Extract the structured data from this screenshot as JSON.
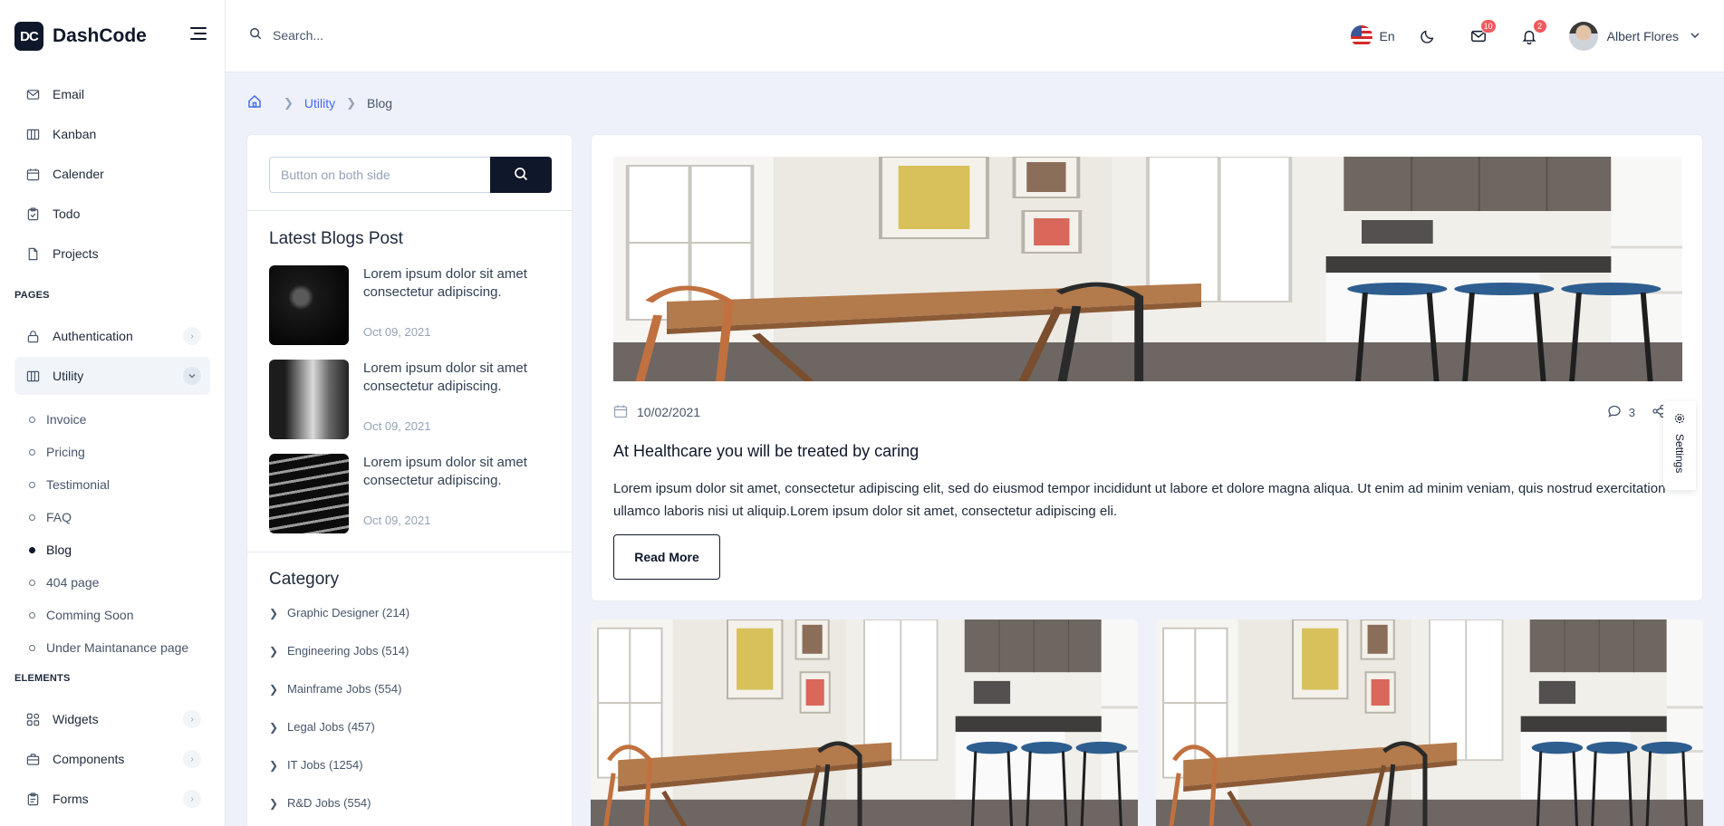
{
  "app": {
    "name": "DashCode",
    "logo_text": "DC"
  },
  "sidebar": {
    "top_items": [
      {
        "label": "Email",
        "icon": "mail-icon"
      },
      {
        "label": "Kanban",
        "icon": "columns-icon"
      },
      {
        "label": "Calender",
        "icon": "calendar-icon"
      },
      {
        "label": "Todo",
        "icon": "clipboard-icon"
      },
      {
        "label": "Projects",
        "icon": "document-icon"
      }
    ],
    "pages_label": "PAGES",
    "authentication": {
      "label": "Authentication",
      "icon": "lock-icon"
    },
    "utility": {
      "label": "Utility",
      "icon": "columns-icon",
      "expanded": true
    },
    "utility_sub": [
      {
        "label": "Invoice"
      },
      {
        "label": "Pricing"
      },
      {
        "label": "Testimonial"
      },
      {
        "label": "FAQ"
      },
      {
        "label": "Blog",
        "active": true
      },
      {
        "label": "404 page"
      },
      {
        "label": "Comming Soon"
      },
      {
        "label": "Under Maintanance page"
      }
    ],
    "elements_label": "ELEMENTS",
    "element_items": [
      {
        "label": "Widgets",
        "icon": "grid-icon"
      },
      {
        "label": "Components",
        "icon": "briefcase-icon"
      },
      {
        "label": "Forms",
        "icon": "clipboard-icon"
      }
    ]
  },
  "header": {
    "search_placeholder": "Search...",
    "language": "En",
    "mail_badge": "10",
    "notification_badge": "2",
    "user_name": "Albert Flores"
  },
  "breadcrumb": {
    "parent": "Utility",
    "current": "Blog"
  },
  "left_panel": {
    "search_placeholder": "Button on both side",
    "latest_heading": "Latest Blogs Post",
    "posts": [
      {
        "title": "Lorem ipsum dolor sit amet consectetur adipiscing.",
        "date": "Oct 09, 2021"
      },
      {
        "title": "Lorem ipsum dolor sit amet consectetur adipiscing.",
        "date": "Oct 09, 2021"
      },
      {
        "title": "Lorem ipsum dolor sit amet consectetur adipiscing.",
        "date": "Oct 09, 2021"
      }
    ],
    "category_heading": "Category",
    "categories": [
      {
        "label": "Graphic Designer (214)"
      },
      {
        "label": "Engineering Jobs (514)"
      },
      {
        "label": "Mainframe Jobs (554)"
      },
      {
        "label": "Legal Jobs (457)"
      },
      {
        "label": "IT Jobs (1254)"
      },
      {
        "label": "R&D Jobs (554)"
      }
    ]
  },
  "blog": {
    "date": "10/02/2021",
    "comments": "3",
    "title": "At Healthcare you will be treated by caring",
    "body": "Lorem ipsum dolor sit amet, consectetur adipiscing elit, sed do eiusmod tempor incididunt ut labore et dolore magna aliqua. Ut enim ad minim veniam, quis nostrud exercitation ullamco laboris nisi ut aliquip.Lorem ipsum dolor sit amet, consectetur adipiscing eli.",
    "read_more": "Read More"
  },
  "settings_tab": {
    "label": "Settings"
  }
}
